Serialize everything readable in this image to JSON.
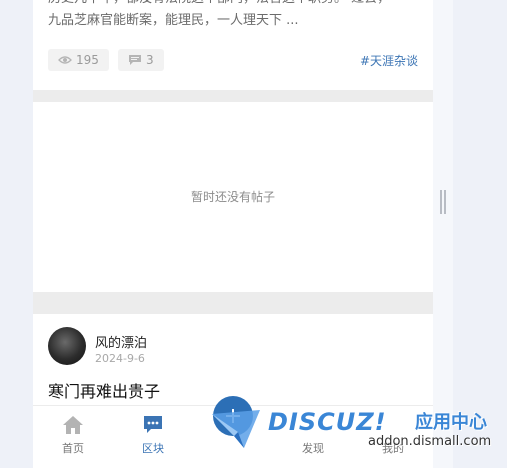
{
  "post_prev": {
    "excerpt_line1": "历史几十年，都没有法院这个部门，法官这个职务。 过去，",
    "excerpt_line2": "九品芝麻官能断案，能理民，一人理天下 ...",
    "views": "195",
    "comments": "3",
    "tag": "#天涯杂谈"
  },
  "empty_section": {
    "message": "暂时还没有帖子"
  },
  "post_next": {
    "author": "风的漂泊",
    "date": "2024-9-6",
    "title": "寒门再难出贵子"
  },
  "tabbar": {
    "items": [
      {
        "label": "首页",
        "icon": "home-icon"
      },
      {
        "label": "区块",
        "icon": "forum-icon"
      },
      {
        "label": "",
        "icon": "post-icon"
      },
      {
        "label": "发现",
        "icon": "discover-icon"
      },
      {
        "label": "我的",
        "icon": "user-icon"
      }
    ]
  },
  "watermark": {
    "brand": "DISCUZ!",
    "subtitle": "应用中心",
    "url": "addon.dismall.com"
  },
  "colors": {
    "accent": "#3b74b4",
    "background": "#eef1f8"
  }
}
